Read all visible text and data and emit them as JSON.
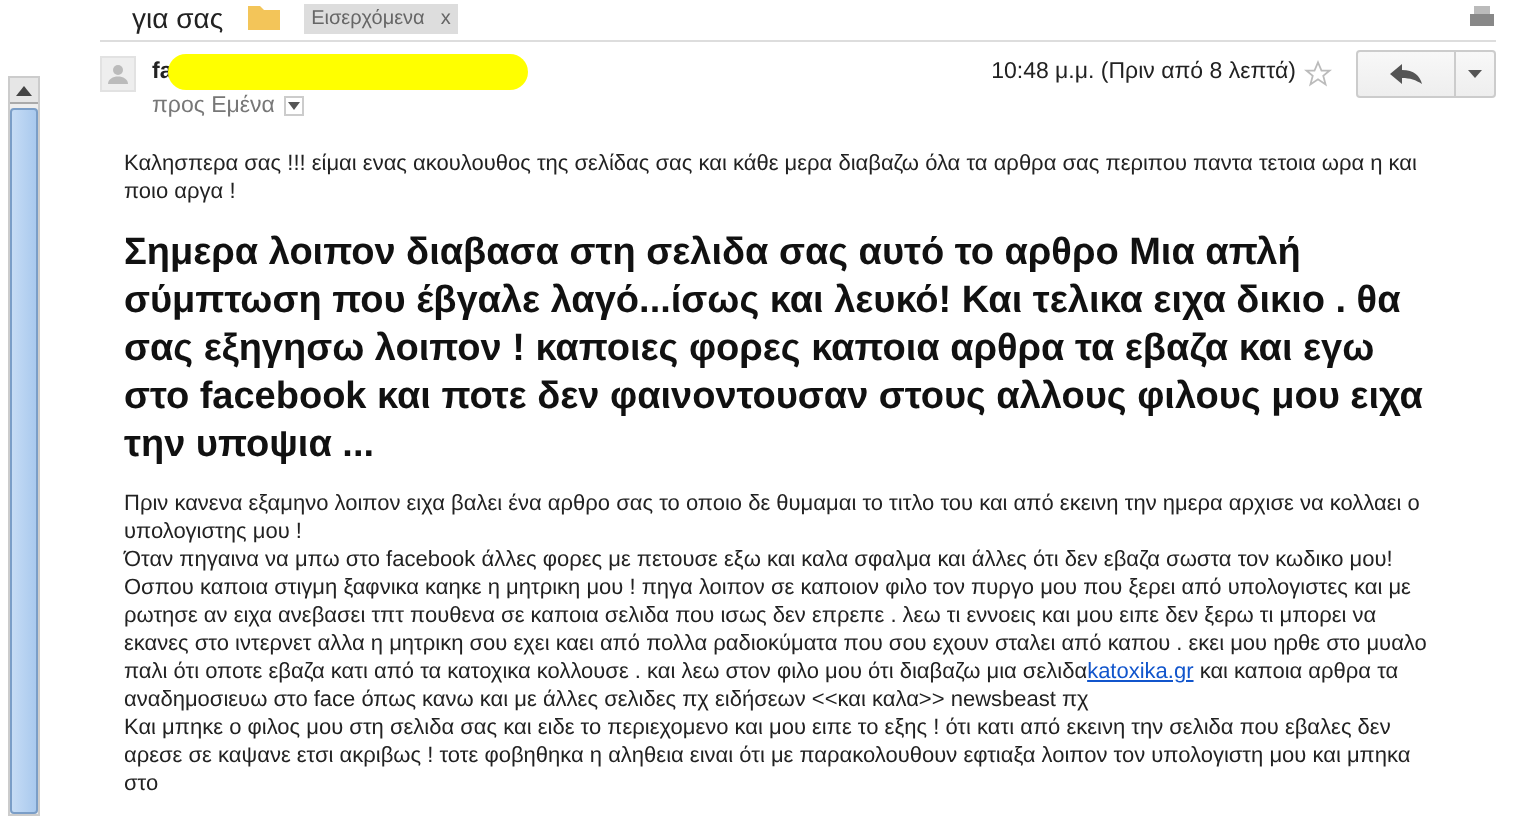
{
  "header": {
    "subject": "για σας",
    "label": {
      "text": "Εισερχόμενα",
      "close": "x"
    }
  },
  "message": {
    "sender": "fa",
    "sender_redacted": true,
    "recipient": "προς Εμένα",
    "time": "10:48 μ.μ. (Πριν από 8 λεπτά)",
    "starred": false
  },
  "body": {
    "intro": "Καλησπερα σας !!! είμαι ενας ακουλουθος της σελίδας σας και κάθε μερα διαβαζω όλα τα αρθρα σας περιπου παντα τετοια ωρα η και ποιο αργα !",
    "headline": "Σημερα λοιπον διαβασα στη σελιδα σας αυτό το αρθρο Μια απλή σύμπτωση που έβγαλε λαγό...ίσως και λευκό! Και τελικα ειχα δικιο . θα σας εξηγησω λοιπον ! καποιες φορες καποια αρθρα τα εβαζα και εγω στο facebook και ποτε δεν φαινοντουσαν στους αλλους φιλους μου ειχα την υποψια ...",
    "lines": [
      {
        "text": "Πριν κανενα εξαμηνο λοιπον ειχα βαλει ένα αρθρο σας το οποιο δε θυμαμαι το τιτλο του και από εκεινη την ημερα αρχισε να κολλαει ο υπολογιστης μου !"
      },
      {
        "text": "Όταν πηγαινα να μπω στο facebook άλλες φορες με πετουσε εξω και καλα σφαλμα και άλλες ότι δεν εβαζα σωστα τον κωδικο μου!"
      },
      {
        "text": "Οσπου καποια στιγμη ξαφνικα καηκε η μητρικη μου ! πηγα λοιπον σε καποιον φιλο τον πυργο μου που ξερει από υπολογιστες και με ρωτησε αν ειχα ανεβασει τπτ πουθενα σε καποια σελιδα που ισως δεν επρεπε . λεω τι εννοεις και μου ειπε δεν ξερω τι μπορει να εκανες στο ιντερνετ αλλα η μητρικη σου εχει καει από πολλα ραδιοκύματα που σου εχουν σταλει από καπου . εκει μου ηρθε στο μυαλο παλι ότι οποτε εβαζα κατι από τα κατοχικα κολλουσε . και λεω στον φιλο μου ότι διαβαζω μια σελιδα",
        "link": "katoxika.gr",
        "after": "και καποια αρθρα τα αναδημοσιευω στο face όπως κανω και με άλλες σελιδες πχ ειδήσεων <<και καλα>> newsbeast πχ"
      },
      {
        "text": "Και μπηκε ο φιλος μου στη σελιδα σας και ειδε το περιεχομενο και μου ειπε το εξης ! ότι κατι από εκεινη την σελιδα που εβαλες δεν αρεσε σε καψανε ετσι ακριβως ! τοτε φοβηθηκα η αληθεια ειναι ότι με παρακολουθουν εφτιαξα λοιπον τον υπολογιστη μου και μπηκα στο"
      }
    ]
  }
}
